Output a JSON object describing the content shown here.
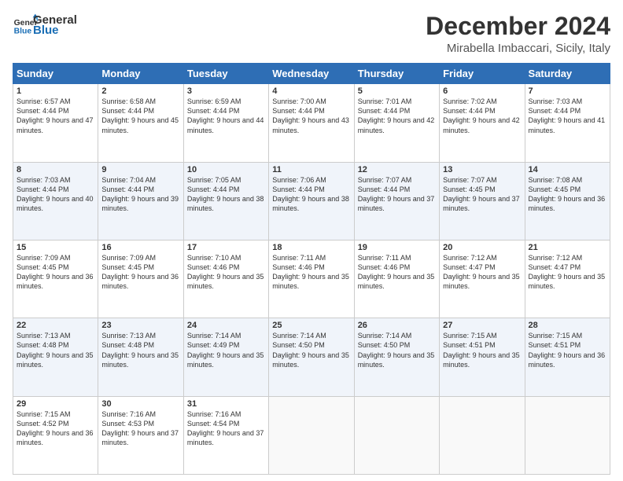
{
  "logo": {
    "line1": "General",
    "line2": "Blue"
  },
  "title": "December 2024",
  "subtitle": "Mirabella Imbaccari, Sicily, Italy",
  "weekdays": [
    "Sunday",
    "Monday",
    "Tuesday",
    "Wednesday",
    "Thursday",
    "Friday",
    "Saturday"
  ],
  "weeks": [
    [
      {
        "day": "1",
        "sunrise": "6:57 AM",
        "sunset": "4:44 PM",
        "daylight": "9 hours and 47 minutes."
      },
      {
        "day": "2",
        "sunrise": "6:58 AM",
        "sunset": "4:44 PM",
        "daylight": "9 hours and 45 minutes."
      },
      {
        "day": "3",
        "sunrise": "6:59 AM",
        "sunset": "4:44 PM",
        "daylight": "9 hours and 44 minutes."
      },
      {
        "day": "4",
        "sunrise": "7:00 AM",
        "sunset": "4:44 PM",
        "daylight": "9 hours and 43 minutes."
      },
      {
        "day": "5",
        "sunrise": "7:01 AM",
        "sunset": "4:44 PM",
        "daylight": "9 hours and 42 minutes."
      },
      {
        "day": "6",
        "sunrise": "7:02 AM",
        "sunset": "4:44 PM",
        "daylight": "9 hours and 42 minutes."
      },
      {
        "day": "7",
        "sunrise": "7:03 AM",
        "sunset": "4:44 PM",
        "daylight": "9 hours and 41 minutes."
      }
    ],
    [
      {
        "day": "8",
        "sunrise": "7:03 AM",
        "sunset": "4:44 PM",
        "daylight": "9 hours and 40 minutes."
      },
      {
        "day": "9",
        "sunrise": "7:04 AM",
        "sunset": "4:44 PM",
        "daylight": "9 hours and 39 minutes."
      },
      {
        "day": "10",
        "sunrise": "7:05 AM",
        "sunset": "4:44 PM",
        "daylight": "9 hours and 38 minutes."
      },
      {
        "day": "11",
        "sunrise": "7:06 AM",
        "sunset": "4:44 PM",
        "daylight": "9 hours and 38 minutes."
      },
      {
        "day": "12",
        "sunrise": "7:07 AM",
        "sunset": "4:44 PM",
        "daylight": "9 hours and 37 minutes."
      },
      {
        "day": "13",
        "sunrise": "7:07 AM",
        "sunset": "4:45 PM",
        "daylight": "9 hours and 37 minutes."
      },
      {
        "day": "14",
        "sunrise": "7:08 AM",
        "sunset": "4:45 PM",
        "daylight": "9 hours and 36 minutes."
      }
    ],
    [
      {
        "day": "15",
        "sunrise": "7:09 AM",
        "sunset": "4:45 PM",
        "daylight": "9 hours and 36 minutes."
      },
      {
        "day": "16",
        "sunrise": "7:09 AM",
        "sunset": "4:45 PM",
        "daylight": "9 hours and 36 minutes."
      },
      {
        "day": "17",
        "sunrise": "7:10 AM",
        "sunset": "4:46 PM",
        "daylight": "9 hours and 35 minutes."
      },
      {
        "day": "18",
        "sunrise": "7:11 AM",
        "sunset": "4:46 PM",
        "daylight": "9 hours and 35 minutes."
      },
      {
        "day": "19",
        "sunrise": "7:11 AM",
        "sunset": "4:46 PM",
        "daylight": "9 hours and 35 minutes."
      },
      {
        "day": "20",
        "sunrise": "7:12 AM",
        "sunset": "4:47 PM",
        "daylight": "9 hours and 35 minutes."
      },
      {
        "day": "21",
        "sunrise": "7:12 AM",
        "sunset": "4:47 PM",
        "daylight": "9 hours and 35 minutes."
      }
    ],
    [
      {
        "day": "22",
        "sunrise": "7:13 AM",
        "sunset": "4:48 PM",
        "daylight": "9 hours and 35 minutes."
      },
      {
        "day": "23",
        "sunrise": "7:13 AM",
        "sunset": "4:48 PM",
        "daylight": "9 hours and 35 minutes."
      },
      {
        "day": "24",
        "sunrise": "7:14 AM",
        "sunset": "4:49 PM",
        "daylight": "9 hours and 35 minutes."
      },
      {
        "day": "25",
        "sunrise": "7:14 AM",
        "sunset": "4:50 PM",
        "daylight": "9 hours and 35 minutes."
      },
      {
        "day": "26",
        "sunrise": "7:14 AM",
        "sunset": "4:50 PM",
        "daylight": "9 hours and 35 minutes."
      },
      {
        "day": "27",
        "sunrise": "7:15 AM",
        "sunset": "4:51 PM",
        "daylight": "9 hours and 35 minutes."
      },
      {
        "day": "28",
        "sunrise": "7:15 AM",
        "sunset": "4:51 PM",
        "daylight": "9 hours and 36 minutes."
      }
    ],
    [
      {
        "day": "29",
        "sunrise": "7:15 AM",
        "sunset": "4:52 PM",
        "daylight": "9 hours and 36 minutes."
      },
      {
        "day": "30",
        "sunrise": "7:16 AM",
        "sunset": "4:53 PM",
        "daylight": "9 hours and 37 minutes."
      },
      {
        "day": "31",
        "sunrise": "7:16 AM",
        "sunset": "4:54 PM",
        "daylight": "9 hours and 37 minutes."
      },
      null,
      null,
      null,
      null
    ]
  ]
}
